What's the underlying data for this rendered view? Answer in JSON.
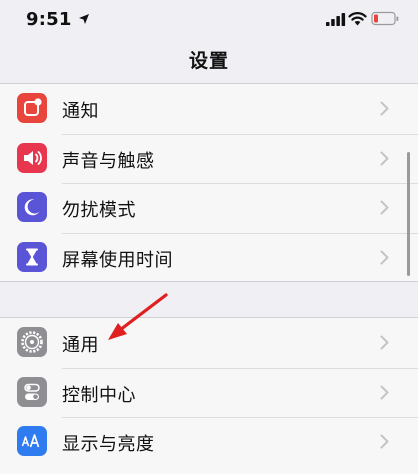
{
  "status_bar": {
    "time": "9:51"
  },
  "nav": {
    "title": "设置"
  },
  "group1": [
    {
      "label": "通知",
      "icon": "notifications-icon",
      "color": "#e8453c"
    },
    {
      "label": "声音与触感",
      "icon": "sound-icon",
      "color": "#e8364f"
    },
    {
      "label": "勿扰模式",
      "icon": "moon-icon",
      "color": "#5a54d6"
    },
    {
      "label": "屏幕使用时间",
      "icon": "hourglass-icon",
      "color": "#5a54d6"
    }
  ],
  "group2": [
    {
      "label": "通用",
      "icon": "gear-icon",
      "color": "#8e8e93"
    },
    {
      "label": "控制中心",
      "icon": "toggle-icon",
      "color": "#8e8e93"
    },
    {
      "label": "显示与亮度",
      "icon": "display-icon",
      "color": "#2f7cf0"
    }
  ],
  "annotation": {
    "color": "#e02020"
  }
}
